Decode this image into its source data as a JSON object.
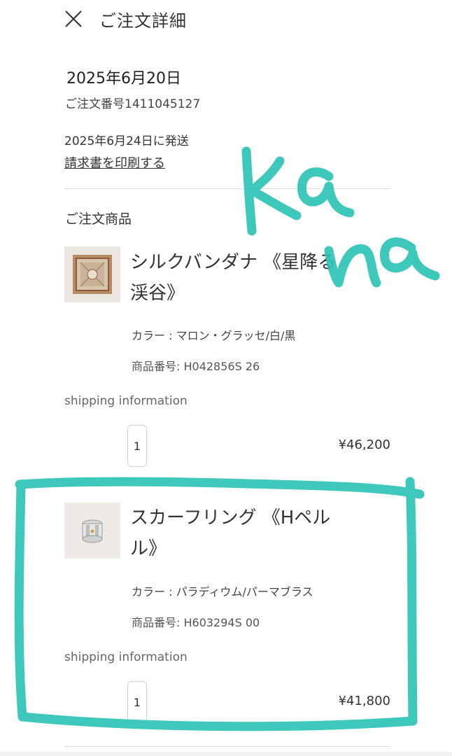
{
  "header": {
    "title": "ご注文詳細",
    "close_icon": "close-icon"
  },
  "order": {
    "date": "2025年6月20日",
    "number": "ご注文番号1411045127",
    "ship_date": "2025年6月24日に発送",
    "print_invoice": "請求書を印刷する"
  },
  "items_section": {
    "title": "ご注文商品"
  },
  "items": [
    {
      "name": "シルクバンダナ 《星降る渓谷》",
      "color": "カラー : マロン・グラッセ/白/黒",
      "product_code": "商品番号: H042856S 26",
      "shipping_info": "shipping information",
      "quantity": "1",
      "price": "¥46,200"
    },
    {
      "name": "スカーフリング 《Hペルル》",
      "color": "カラー : パラディウム/パーマブラス",
      "product_code": "商品番号: H603294S 00",
      "shipping_info": "shipping information",
      "quantity": "1",
      "price": "¥41,800"
    }
  ],
  "colors": {
    "highlight": "#2ec4b6",
    "divider": "#dddddd",
    "text": "#333333"
  }
}
